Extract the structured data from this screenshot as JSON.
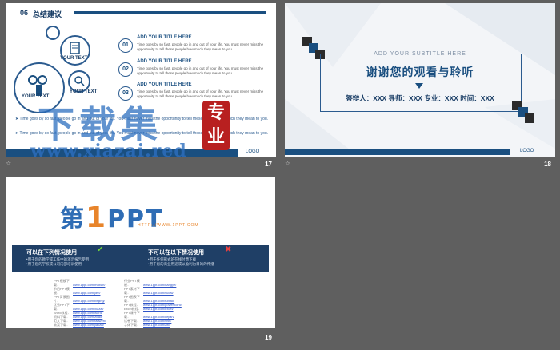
{
  "slides": {
    "s17": {
      "number": "17",
      "section_num": "06",
      "section_title": "总结建议",
      "circle_labels": [
        "YOUR TEXT",
        "YOUR TEXT",
        "YOUR TEXT"
      ],
      "rows": [
        {
          "badge": "01",
          "title": "ADD YOUR TITLE HERE",
          "text": "Time goes by so fast, people go in and out of your life. You must never miss the opportunity to tell these people how much they mean to you."
        },
        {
          "badge": "02",
          "title": "ADD YOUR TITLE HERE",
          "text": "Time goes by so fast, people go in and out of your life. You must never miss the opportunity to tell these people how much they mean to you."
        },
        {
          "badge": "03",
          "title": "ADD YOUR TITLE HERE",
          "text": "Time goes by so fast, people go in and out of your life. You must never miss the opportunity to tell these people how much they mean to you."
        }
      ],
      "bullets": [
        "Time goes by so fast, people go in and out of your life. You must never miss the opportunity to tell these people how much they mean to you.",
        "Time goes by so fast, people go in and out of your life. You must never miss the opportunity to tell these people how much they mean to you."
      ],
      "logo": "LOGO"
    },
    "s18": {
      "number": "18",
      "subtitle": "ADD YOUR SUBTITLE HERE",
      "title": "谢谢您的观看与聆听",
      "info": "答辩人：XXX   导师：XXX   专业：XXX  时间：XXX",
      "logo": "LOGO"
    },
    "s19": {
      "number": "19",
      "brand_pre": "第",
      "brand_one": "1",
      "brand_post": "PPT",
      "brand_url": "HTTP://WWW.1PPT.COM",
      "allowed_title": "可以在下列情况使用",
      "allowed_lines": [
        "•用于您的教学或工作中的演示报告使用",
        "•用于您的学校或公司内部培训使用"
      ],
      "forbidden_title": "不可以在以下情况使用",
      "forbidden_lines": [
        "•用于任何形式的在线付费下载",
        "•用于您的商业用途或以盈利为目的的传播"
      ],
      "links_left": [
        {
          "label": "PPT模板下载：",
          "url": "www.1ppt.com/moban/"
        },
        {
          "label": "节日PPT模板：",
          "url": "www.1ppt.com/jieri/"
        },
        {
          "label": "PPT背景图片：",
          "url": "www.1ppt.com/beijing/"
        },
        {
          "label": "优秀PPT下载：",
          "url": "www.1ppt.com/xiazai/"
        },
        {
          "label": "Word教程：",
          "url": "www.1ppt.com/word/"
        },
        {
          "label": "资料下载：",
          "url": "www.1ppt.com/ziliao/"
        },
        {
          "label": "范文下载：",
          "url": "www.1ppt.com/fanwen/"
        },
        {
          "label": "教案下载：",
          "url": "www.1ppt.com/jiaoan/"
        }
      ],
      "links_right": [
        {
          "label": "行业PPT模板：",
          "url": "www.1ppt.com/hangye/"
        },
        {
          "label": "PPT素材下载：",
          "url": "www.1ppt.com/sucai/"
        },
        {
          "label": "PPT图表下载：",
          "url": "www.1ppt.com/tubiao/"
        },
        {
          "label": "PPT教程：",
          "url": "www.1ppt.com/powerpoint/"
        },
        {
          "label": "Excel教程：",
          "url": "www.1ppt.com/excel/"
        },
        {
          "label": "PPT课件下载：",
          "url": "www.1ppt.com/kejian/"
        },
        {
          "label": "试卷下载：",
          "url": "www.1ppt.com/shiti/"
        },
        {
          "label": "字体下载：",
          "url": "www.1ppt.com/ziti/"
        }
      ]
    }
  },
  "watermark": {
    "cn_text": "下载集",
    "seal_text": [
      "专",
      "业"
    ],
    "url": "www.xiazai.red"
  },
  "colors": {
    "accent": "#1a4f80",
    "background": "#5f5f5f",
    "watermark": "#2d6fbf",
    "seal": "#b82020"
  }
}
